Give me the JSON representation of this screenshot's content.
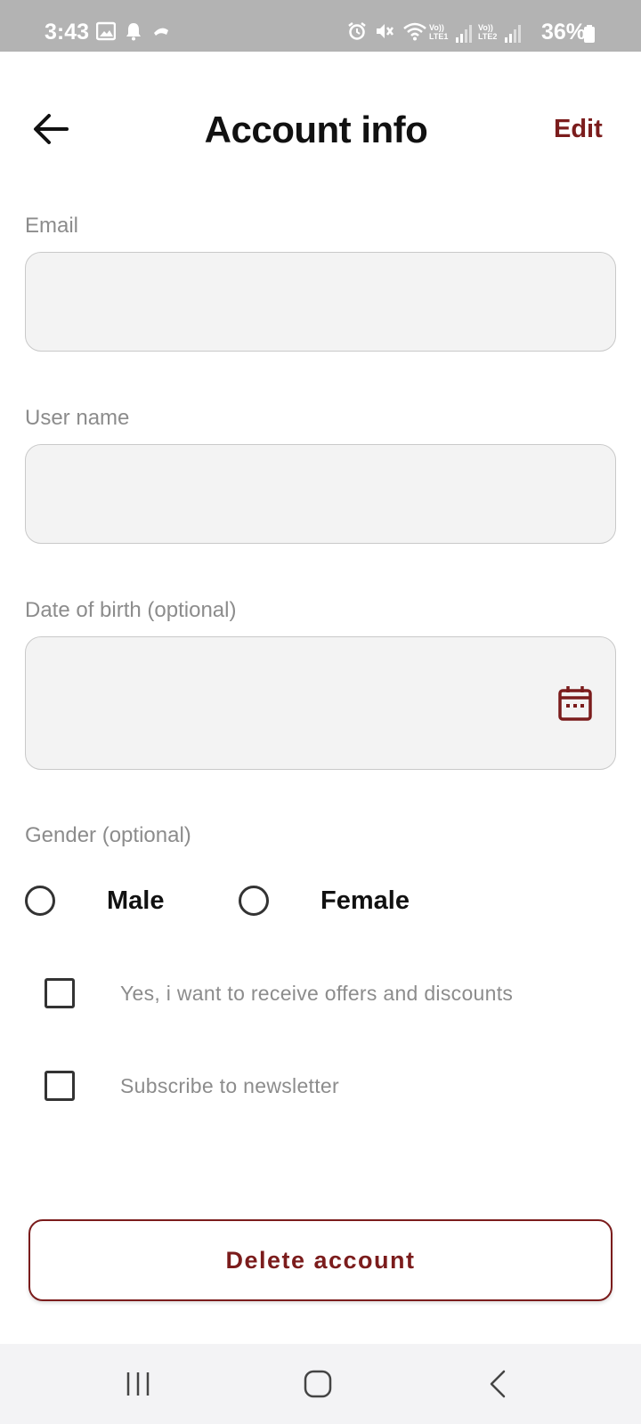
{
  "status_bar": {
    "time": "3:43",
    "battery": "36%",
    "icons": [
      "gallery-icon",
      "notification-icon",
      "app-icon",
      "alarm-icon",
      "mute-icon",
      "wifi-icon",
      "lte1-signal-icon",
      "lte2-signal-icon",
      "battery-icon"
    ],
    "lte1_label": "Vo)) LTE1",
    "lte2_label": "Vo)) LTE2"
  },
  "header": {
    "title": "Account info",
    "edit_label": "Edit",
    "back_icon": "arrow-left-icon"
  },
  "form": {
    "email": {
      "label": "Email",
      "value": "",
      "placeholder": ""
    },
    "username": {
      "label": "User name",
      "value": "",
      "placeholder": ""
    },
    "dob": {
      "label": "Date of birth (optional)",
      "value": "",
      "placeholder": "",
      "icon": "calendar-icon"
    },
    "gender": {
      "label": "Gender (optional)",
      "options": [
        "Male",
        "Female"
      ],
      "selected": null
    },
    "offers": {
      "label": "Yes, i want to receive offers and discounts",
      "checked": false
    },
    "newsletter": {
      "label": "Subscribe to newsletter",
      "checked": false
    }
  },
  "actions": {
    "delete_label": "Delete account"
  },
  "nav_bar": {
    "icons": [
      "recent-apps-icon",
      "home-icon",
      "back-nav-icon"
    ]
  },
  "colors": {
    "accent": "#7b1c1c",
    "status_bar_bg": "#b3b3b3",
    "field_bg": "#f3f3f3",
    "label_gray": "#8c8c8c",
    "nav_bg": "#f3f3f5"
  }
}
